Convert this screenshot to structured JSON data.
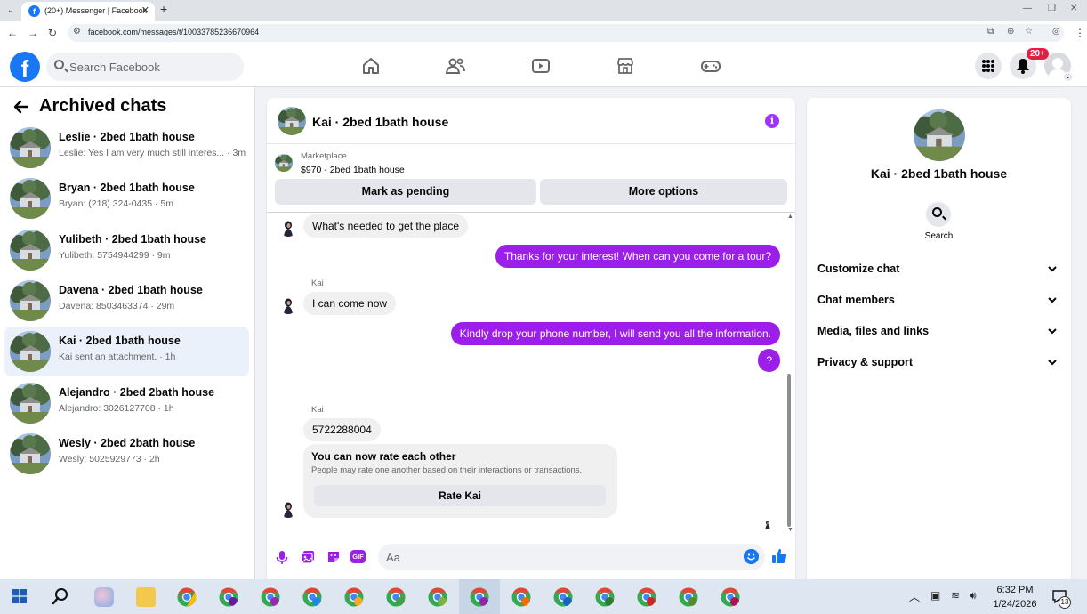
{
  "browser": {
    "tab_title": "(20+) Messenger | Facebook",
    "url": "facebook.com/messages/t/10033785236670964"
  },
  "header": {
    "search_placeholder": "Search Facebook",
    "notification_badge": "20+",
    "nav_icons": [
      "home-icon",
      "friends-icon",
      "watch-icon",
      "marketplace-icon",
      "gaming-icon"
    ]
  },
  "sidebar": {
    "title": "Archived chats",
    "chats": [
      {
        "name": "Leslie · 2bed 1bath house",
        "preview": "Leslie: Yes I am very much still interes... · 3m"
      },
      {
        "name": "Bryan · 2bed 1bath house",
        "preview": "Bryan: (218) 324-0435 · 5m"
      },
      {
        "name": "Yulibeth · 2bed 1bath house",
        "preview": "Yulibeth: 5754944299 · 9m"
      },
      {
        "name": "Davena · 2bed 1bath house",
        "preview": "Davena: 8503463374 · 29m"
      },
      {
        "name": "Kai · 2bed 1bath house",
        "preview": "Kai sent an attachment. · 1h"
      },
      {
        "name": "Alejandro · 2bed 2bath house",
        "preview": "Alejandro: 3026127708 · 1h"
      },
      {
        "name": "Wesly · 2bed 2bath house",
        "preview": "Wesly: 5025929773 · 2h"
      }
    ]
  },
  "chat": {
    "title": "Kai · 2bed 1bath house",
    "marketplace_label": "Marketplace",
    "listing": "$970 - 2bed 1bath house",
    "mark_pending": "Mark as pending",
    "more_options": "More options",
    "messages": {
      "m1": "What's needed to get the place",
      "m2": "Thanks for your interest! When can you come for a tour?",
      "sender1": "Kai",
      "m3": "I can come now",
      "m4": "Kindly drop your phone number, I will send you all the information.",
      "m5": "?",
      "sender2": "Kai",
      "m6": "5722288004"
    },
    "rate": {
      "title": "You can now rate each other",
      "text": "People may rate one another based on their interactions or transactions.",
      "button": "Rate Kai"
    },
    "composer_placeholder": "Aa"
  },
  "info_panel": {
    "name": "Kai · 2bed 1bath house",
    "search_label": "Search",
    "sections": [
      "Customize chat",
      "Chat members",
      "Media, files and links",
      "Privacy & support"
    ]
  },
  "taskbar": {
    "time": "6:32 PM",
    "date": "1/24/2026",
    "notification_count": "13"
  },
  "colors": {
    "brand": "#1877f2",
    "outgoing_bubble": "#9b1fe8",
    "incoming_bubble": "#f0f0f0",
    "active_chat": "#ebf1fb"
  }
}
